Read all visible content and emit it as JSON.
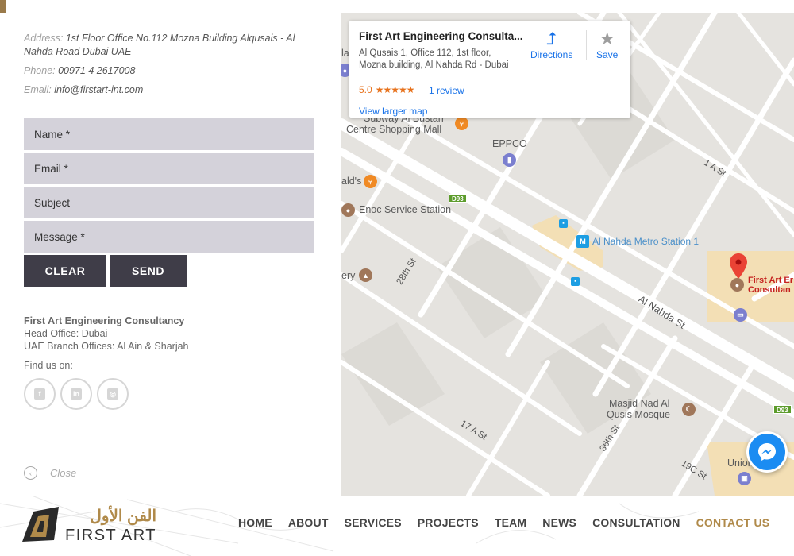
{
  "contact": {
    "address_label": "Address:",
    "address": "1st Floor Office No.112 Mozna Building Alqusais - Al Nahda Road Dubai UAE",
    "phone_label": "Phone:",
    "phone": "00971 4 2617008",
    "email_label": "Email:",
    "email": "info@firstart-int.com"
  },
  "form": {
    "name_placeholder": "Name *",
    "email_placeholder": "Email *",
    "subject_placeholder": "Subject",
    "message_placeholder": "Message *",
    "clear_label": "CLEAR",
    "send_label": "SEND"
  },
  "company": {
    "name": "First Art Engineering Consultancy",
    "head_office": "Head Office: Dubai",
    "branches": "UAE Branch Offices: Al Ain & Sharjah",
    "find_us": "Find us on:"
  },
  "socials": [
    {
      "icon": "facebook-icon",
      "glyph": "f"
    },
    {
      "icon": "linkedin-icon",
      "glyph": "in"
    },
    {
      "icon": "instagram-icon",
      "glyph": "◎"
    }
  ],
  "close_label": "Close",
  "map": {
    "card": {
      "title": "First Art Engineering Consulta...",
      "address_line1": "Al Qusais 1, Office 112, 1st floor,",
      "address_line2": "Mozna building, Al Nahda Rd - Dubai",
      "rating": "5.0",
      "stars": "★★★★★",
      "reviews": "1 review",
      "directions": "Directions",
      "save": "Save",
      "larger_map": "View larger map"
    },
    "labels": {
      "subway": "Subway Al Bustan",
      "mall": "Centre Shopping Mall",
      "eppco": "EPPCO",
      "mcdonalds": "ald's",
      "enoc": "Enoc Service Station",
      "metro": "Al Nahda Metro Station 1",
      "bakery": "ery",
      "street_28th": "28th St",
      "al_nahda_st": "Al Nahda St",
      "one_a_st": "1 A St",
      "seventeen_a_st": "17 A St",
      "thirtysixth_st": "36th St",
      "nineteen_c_st": "19C St",
      "mosque_line1": "Masjid Nad Al",
      "mosque_line2": "Qusis Mosque",
      "union": "Union",
      "la": "la",
      "shield_d93": "D93",
      "pin_line1": "First Art Er",
      "pin_line2": "Consultan"
    }
  },
  "logo": {
    "arabic": "الفن الأول",
    "english": "FIRST ART"
  },
  "nav": [
    {
      "label": "HOME",
      "active": false
    },
    {
      "label": "ABOUT",
      "active": false
    },
    {
      "label": "SERVICES",
      "active": false
    },
    {
      "label": "PROJECTS",
      "active": false
    },
    {
      "label": "TEAM",
      "active": false
    },
    {
      "label": "NEWS",
      "active": false
    },
    {
      "label": "CONSULTATION",
      "active": false
    },
    {
      "label": "CONTACT US",
      "active": true
    }
  ],
  "colors": {
    "accent": "#b08a4a",
    "form_field": "#d4d2da",
    "button": "#3f3d48",
    "map_bg": "#e5e3df",
    "link_blue": "#1a73e8"
  }
}
